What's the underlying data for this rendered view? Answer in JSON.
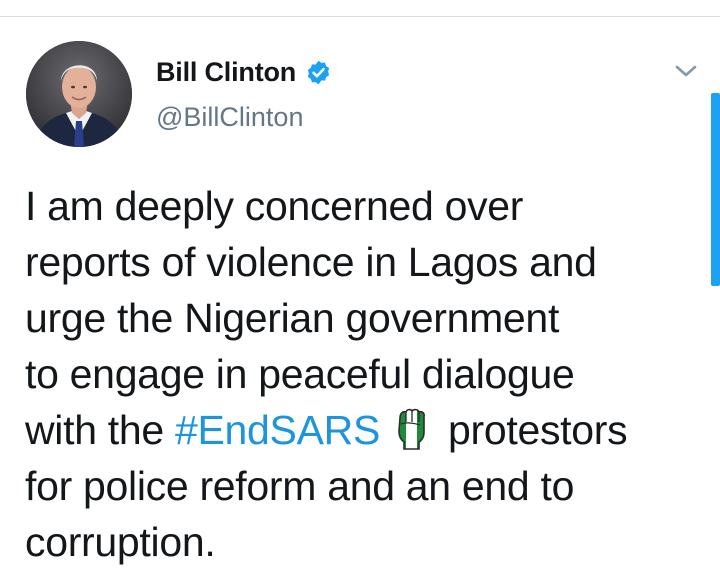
{
  "colors": {
    "verified": "#1da1f2",
    "hashtag": "#1b95e0",
    "handle": "#657786",
    "text": "#14171a",
    "scrollbar": "#1da1f2"
  },
  "author": {
    "display_name": "Bill Clinton",
    "handle": "@BillClinton",
    "verified": true,
    "avatar_icon": "profile-photo"
  },
  "tweet": {
    "line1": "I am deeply concerned over",
    "line2": "reports of violence in Lagos and",
    "line3": "urge the Nigerian government",
    "line4": "to engage in peaceful dialogue",
    "line5_prefix": "with the ",
    "hashtag": "#EndSARS",
    "emoji_icon": "raised-fist-nigeria-flag-emoji",
    "line5_suffix": "protestors",
    "line6": "for police reform and an end to",
    "line7": "corruption."
  },
  "icons": {
    "menu": "chevron-down-icon",
    "verified": "verified-badge-icon"
  }
}
